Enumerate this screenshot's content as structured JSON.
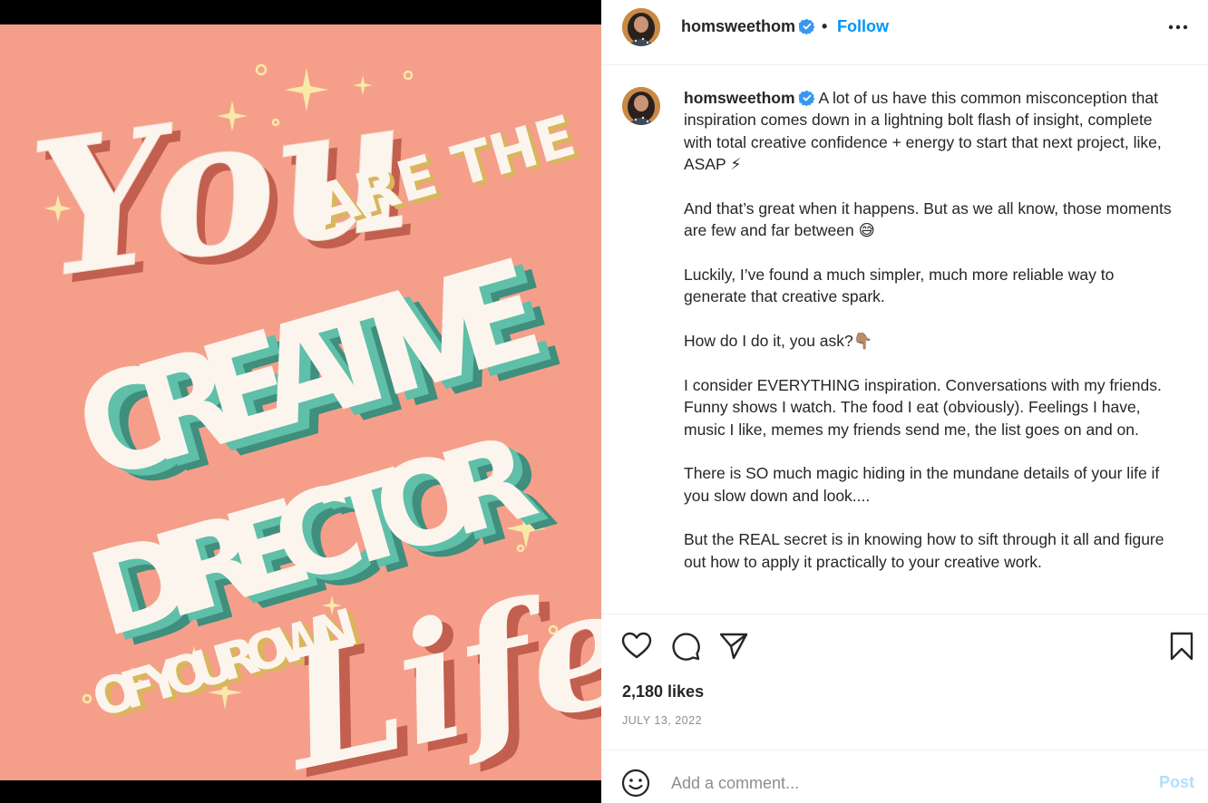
{
  "artwork": {
    "text_you": "You",
    "text_are_the": "ARE THE",
    "text_creative": "CREATIVE",
    "text_director": "DIRECTOR",
    "text_of_your_own": "OF YOUR OWN",
    "text_life": "Life",
    "colors": {
      "background": "#f59f8a",
      "teal": "#5fbfa8",
      "shadow": "#c25f4e",
      "gold": "#d9b65c",
      "white": "#fbf5ee"
    }
  },
  "header": {
    "username": "homsweethom",
    "separator": "•",
    "follow_label": "Follow",
    "verified_icon": "verified-badge-icon",
    "more_icon": "more-options-icon"
  },
  "caption": {
    "username": "homsweethom",
    "paragraphs": [
      "A lot of us have this common misconception that inspiration comes down in a lightning bolt flash of insight, complete with total creative confidence + energy to start that next project, like, ASAP ⚡",
      "And that’s great when it happens. But as we all know, those moments are few and far between 😅",
      "Luckily, I’ve found a much simpler, much more reliable way to generate that creative spark.",
      "How do I do it, you ask?👇🏽",
      "I consider EVERYTHING inspiration. Conversations with my friends. Funny shows I watch. The food I eat (obviously). Feelings I have, music I like, memes my friends send me, the list goes on and on.",
      "There is SO much magic hiding in the mundane details of your life if you slow down and look....",
      "But the REAL secret is in knowing how to sift through it all and figure out how to apply it practically to your creative work."
    ]
  },
  "actions": {
    "like_icon": "heart-icon",
    "comment_icon": "comment-icon",
    "share_icon": "share-icon",
    "save_icon": "bookmark-icon"
  },
  "likes": "2,180 likes",
  "date": "JULY 13, 2022",
  "comment": {
    "placeholder": "Add a comment...",
    "post_label": "Post",
    "emoji_icon": "emoji-icon"
  }
}
